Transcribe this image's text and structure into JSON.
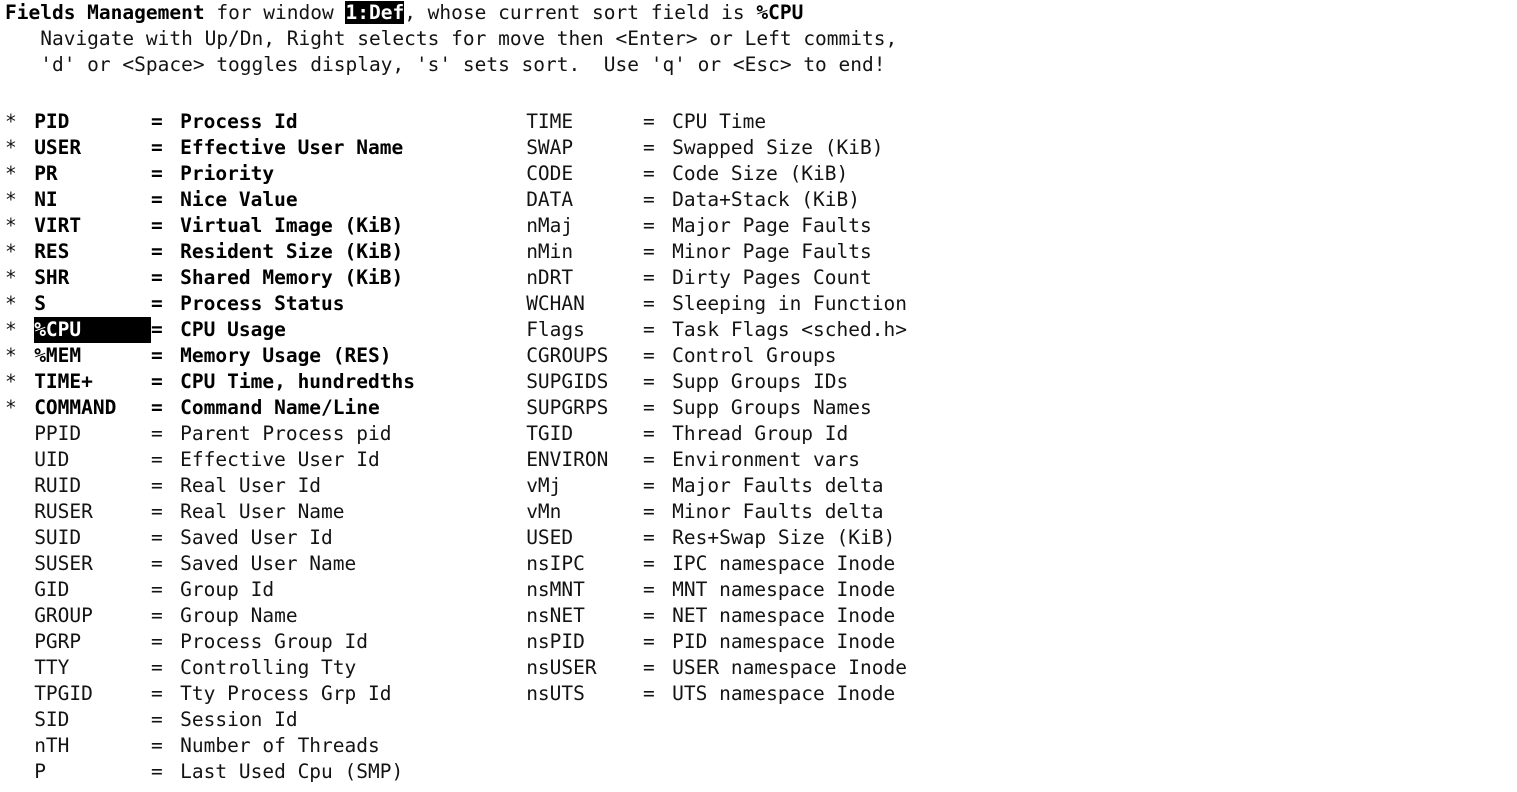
{
  "header": {
    "line1": {
      "title": "Fields Management",
      "mid1": " for window ",
      "window": "1:Def",
      "mid2": ", whose current sort field is ",
      "sort_field": "%CPU"
    },
    "line2": "   Navigate with Up/Dn, Right selects for move then <Enter> or Left commits,",
    "line3": "   'd' or <Space> toggles display, 's' sets sort.  Use 'q' or <Esc> to end!"
  },
  "legend": {
    "selected_marker": "*",
    "equals": "=",
    "cursor_field": "%CPU"
  },
  "columns": {
    "left": [
      {
        "flag": "*",
        "name": "PID",
        "desc": "Process Id",
        "on": true,
        "cursor": false
      },
      {
        "flag": "*",
        "name": "USER",
        "desc": "Effective User Name",
        "on": true,
        "cursor": false
      },
      {
        "flag": "*",
        "name": "PR",
        "desc": "Priority",
        "on": true,
        "cursor": false
      },
      {
        "flag": "*",
        "name": "NI",
        "desc": "Nice Value",
        "on": true,
        "cursor": false
      },
      {
        "flag": "*",
        "name": "VIRT",
        "desc": "Virtual Image (KiB)",
        "on": true,
        "cursor": false
      },
      {
        "flag": "*",
        "name": "RES",
        "desc": "Resident Size (KiB)",
        "on": true,
        "cursor": false
      },
      {
        "flag": "*",
        "name": "SHR",
        "desc": "Shared Memory (KiB)",
        "on": true,
        "cursor": false
      },
      {
        "flag": "*",
        "name": "S",
        "desc": "Process Status",
        "on": true,
        "cursor": false
      },
      {
        "flag": "*",
        "name": "%CPU",
        "desc": "CPU Usage",
        "on": true,
        "cursor": true
      },
      {
        "flag": "*",
        "name": "%MEM",
        "desc": "Memory Usage (RES)",
        "on": true,
        "cursor": false
      },
      {
        "flag": "*",
        "name": "TIME+",
        "desc": "CPU Time, hundredths",
        "on": true,
        "cursor": false
      },
      {
        "flag": "*",
        "name": "COMMAND",
        "desc": "Command Name/Line",
        "on": true,
        "cursor": false
      },
      {
        "flag": " ",
        "name": "PPID",
        "desc": "Parent Process pid",
        "on": false,
        "cursor": false
      },
      {
        "flag": " ",
        "name": "UID",
        "desc": "Effective User Id",
        "on": false,
        "cursor": false
      },
      {
        "flag": " ",
        "name": "RUID",
        "desc": "Real User Id",
        "on": false,
        "cursor": false
      },
      {
        "flag": " ",
        "name": "RUSER",
        "desc": "Real User Name",
        "on": false,
        "cursor": false
      },
      {
        "flag": " ",
        "name": "SUID",
        "desc": "Saved User Id",
        "on": false,
        "cursor": false
      },
      {
        "flag": " ",
        "name": "SUSER",
        "desc": "Saved User Name",
        "on": false,
        "cursor": false
      },
      {
        "flag": " ",
        "name": "GID",
        "desc": "Group Id",
        "on": false,
        "cursor": false
      },
      {
        "flag": " ",
        "name": "GROUP",
        "desc": "Group Name",
        "on": false,
        "cursor": false
      },
      {
        "flag": " ",
        "name": "PGRP",
        "desc": "Process Group Id",
        "on": false,
        "cursor": false
      },
      {
        "flag": " ",
        "name": "TTY",
        "desc": "Controlling Tty",
        "on": false,
        "cursor": false
      },
      {
        "flag": " ",
        "name": "TPGID",
        "desc": "Tty Process Grp Id",
        "on": false,
        "cursor": false
      },
      {
        "flag": " ",
        "name": "SID",
        "desc": "Session Id",
        "on": false,
        "cursor": false
      },
      {
        "flag": " ",
        "name": "nTH",
        "desc": "Number of Threads",
        "on": false,
        "cursor": false
      },
      {
        "flag": " ",
        "name": "P",
        "desc": "Last Used Cpu (SMP)",
        "on": false,
        "cursor": false
      }
    ],
    "right": [
      {
        "flag": " ",
        "name": "TIME",
        "desc": "CPU Time",
        "on": false,
        "cursor": false
      },
      {
        "flag": " ",
        "name": "SWAP",
        "desc": "Swapped Size (KiB)",
        "on": false,
        "cursor": false
      },
      {
        "flag": " ",
        "name": "CODE",
        "desc": "Code Size (KiB)",
        "on": false,
        "cursor": false
      },
      {
        "flag": " ",
        "name": "DATA",
        "desc": "Data+Stack (KiB)",
        "on": false,
        "cursor": false
      },
      {
        "flag": " ",
        "name": "nMaj",
        "desc": "Major Page Faults",
        "on": false,
        "cursor": false
      },
      {
        "flag": " ",
        "name": "nMin",
        "desc": "Minor Page Faults",
        "on": false,
        "cursor": false
      },
      {
        "flag": " ",
        "name": "nDRT",
        "desc": "Dirty Pages Count",
        "on": false,
        "cursor": false
      },
      {
        "flag": " ",
        "name": "WCHAN",
        "desc": "Sleeping in Function",
        "on": false,
        "cursor": false
      },
      {
        "flag": " ",
        "name": "Flags",
        "desc": "Task Flags <sched.h>",
        "on": false,
        "cursor": false
      },
      {
        "flag": " ",
        "name": "CGROUPS",
        "desc": "Control Groups",
        "on": false,
        "cursor": false
      },
      {
        "flag": " ",
        "name": "SUPGIDS",
        "desc": "Supp Groups IDs",
        "on": false,
        "cursor": false
      },
      {
        "flag": " ",
        "name": "SUPGRPS",
        "desc": "Supp Groups Names",
        "on": false,
        "cursor": false
      },
      {
        "flag": " ",
        "name": "TGID",
        "desc": "Thread Group Id",
        "on": false,
        "cursor": false
      },
      {
        "flag": " ",
        "name": "ENVIRON",
        "desc": "Environment vars",
        "on": false,
        "cursor": false
      },
      {
        "flag": " ",
        "name": "vMj",
        "desc": "Major Faults delta",
        "on": false,
        "cursor": false
      },
      {
        "flag": " ",
        "name": "vMn",
        "desc": "Minor Faults delta",
        "on": false,
        "cursor": false
      },
      {
        "flag": " ",
        "name": "USED",
        "desc": "Res+Swap Size (KiB)",
        "on": false,
        "cursor": false
      },
      {
        "flag": " ",
        "name": "nsIPC",
        "desc": "IPC namespace Inode",
        "on": false,
        "cursor": false
      },
      {
        "flag": " ",
        "name": "nsMNT",
        "desc": "MNT namespace Inode",
        "on": false,
        "cursor": false
      },
      {
        "flag": " ",
        "name": "nsNET",
        "desc": "NET namespace Inode",
        "on": false,
        "cursor": false
      },
      {
        "flag": " ",
        "name": "nsPID",
        "desc": "PID namespace Inode",
        "on": false,
        "cursor": false
      },
      {
        "flag": " ",
        "name": "nsUSER",
        "desc": "USER namespace Inode",
        "on": false,
        "cursor": false
      },
      {
        "flag": " ",
        "name": "nsUTS",
        "desc": "UTS namespace Inode",
        "on": false,
        "cursor": false
      }
    ]
  },
  "colors": {
    "background": "#ffffff",
    "foreground": "#000000",
    "dim_foreground": "#131313",
    "reverse_background": "#000000",
    "reverse_foreground": "#ffffff"
  }
}
